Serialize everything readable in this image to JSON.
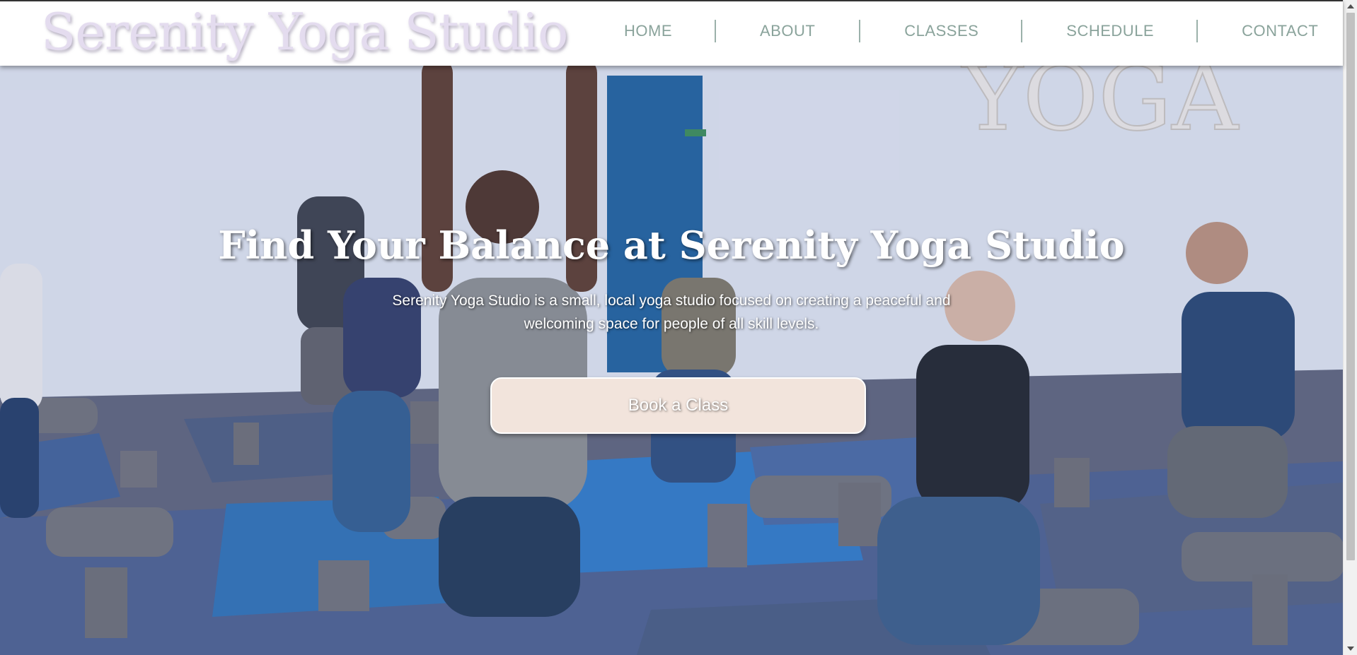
{
  "header": {
    "logo": "Serenity Yoga Studio",
    "nav": [
      {
        "label": "HOME"
      },
      {
        "label": "ABOUT"
      },
      {
        "label": "CLASSES"
      },
      {
        "label": "SCHEDULE"
      },
      {
        "label": "CONTACT"
      }
    ]
  },
  "hero": {
    "title": "Find Your Balance at Serenity Yoga Studio",
    "subtitle": "Serenity Yoga Studio is a small, local yoga studio focused on creating a peaceful and welcoming space for people of all skill levels.",
    "cta_label": "Book a Class",
    "wall_sign": "YOGA"
  },
  "colors": {
    "nav_text": "#8aa39b",
    "logo": "#e4dcef",
    "cta_background": "#f2e4dc"
  }
}
